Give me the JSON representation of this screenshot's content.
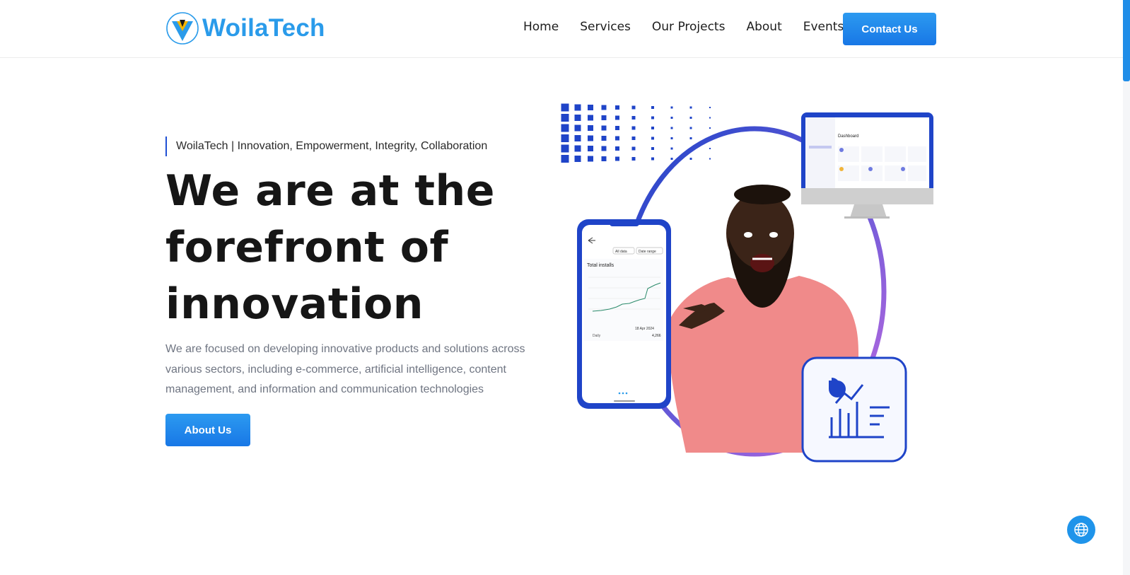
{
  "brand": {
    "name": "WoilaTech",
    "color": "#2a9bea"
  },
  "nav": {
    "items": [
      "Home",
      "Services",
      "Our Projects",
      "About",
      "Events"
    ],
    "cta_label": "Contact Us"
  },
  "hero": {
    "tagline": "WoilaTech | Innovation, Empowerment, Integrity, Collaboration",
    "headline_lines": [
      "We are at the",
      "forefront of",
      "innovation"
    ],
    "description": "We are focused on developing innovative products and solutions across various sectors, including e-commerce, artificial intelligence, content management, and information and communication technologies",
    "button_label": "About Us"
  },
  "illustration": {
    "phone": {
      "filters": [
        "All data",
        "Date range"
      ],
      "card_title": "Total installs",
      "date_label": "18 Apr 2024",
      "legend": "Daily",
      "value": "4,266"
    },
    "monitor": {
      "page_title": "Dashboard"
    },
    "icons": [
      "analytics-chart-icon"
    ]
  },
  "floating": {
    "icon": "globe-icon"
  },
  "colors": {
    "accent": "#1f8de8",
    "dark_blue": "#1f44c8",
    "purple": "#c46ce0",
    "shirt": "#f08a8a"
  }
}
